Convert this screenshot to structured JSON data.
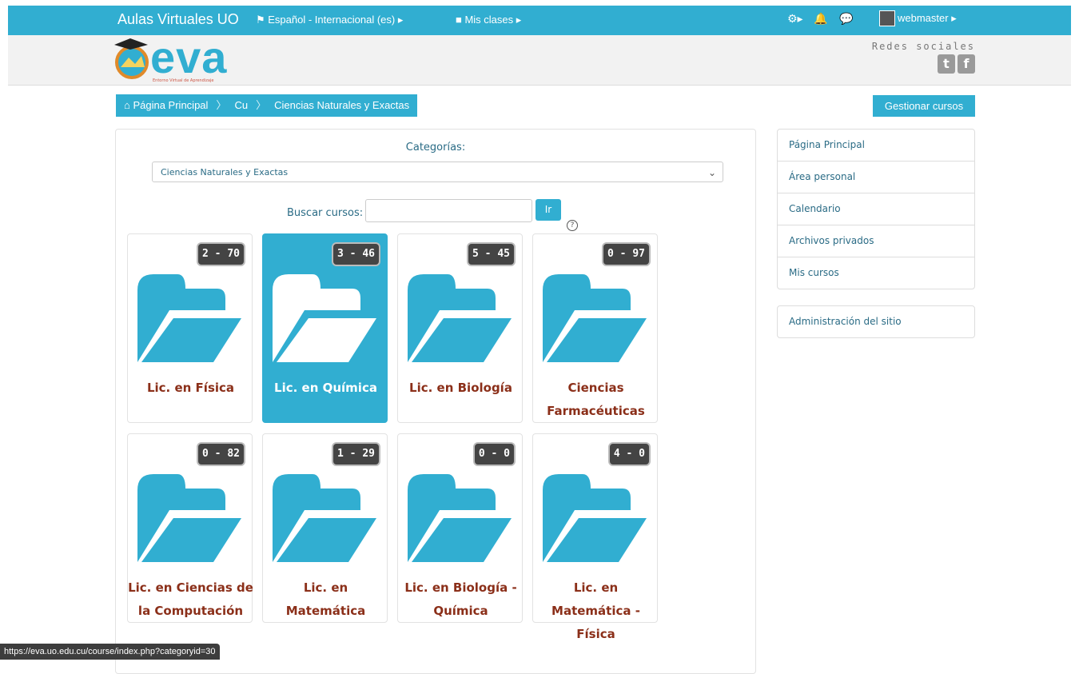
{
  "nav": {
    "site_name": "Aulas Virtuales UO",
    "language": "⚑ Español - Internacional (es) ▸",
    "classes": "■ Mis clases ▸",
    "user": "webmaster ▸",
    "settings_icon": "gear-icon",
    "notifications_icon": "bell-icon",
    "messages_icon": "chat-icon"
  },
  "header": {
    "logo_text": "eva",
    "logo_sub": "Entorno Virtual de Aprendizaje",
    "social_label": "Redes sociales"
  },
  "breadcrumb": [
    "Página Principal",
    "Cu",
    "Ciencias Naturales y Exactas"
  ],
  "manage_button": "Gestionar cursos",
  "categories": {
    "label": "Categorías:",
    "selected": "Ciencias Naturales y Exactas"
  },
  "search": {
    "label": "Buscar cursos:",
    "go_label": "Ir",
    "value": ""
  },
  "tiles": [
    {
      "badge": "2 - 70",
      "name": "Lic. en Física",
      "active": false
    },
    {
      "badge": "3 - 46",
      "name": "Lic. en Química",
      "active": true
    },
    {
      "badge": "5 - 45",
      "name": "Lic. en Biología",
      "active": false
    },
    {
      "badge": "0 - 97",
      "name": "Ciencias Farmacéuticas",
      "active": false
    },
    {
      "badge": "0 - 82",
      "name": "Lic. en Ciencias de la Computación",
      "active": false
    },
    {
      "badge": "1 - 29",
      "name": "Lic. en Matemática",
      "active": false
    },
    {
      "badge": "0 - 0",
      "name": "Lic. en Biología - Química",
      "active": false
    },
    {
      "badge": "4 - 0",
      "name": "Lic. en Matemática - Física",
      "active": false
    }
  ],
  "sidebar": {
    "nav": [
      "Página Principal",
      "Área personal",
      "Calendario",
      "Archivos privados",
      "Mis cursos"
    ],
    "admin": [
      "Administración del sitio"
    ]
  },
  "status_url": "https://eva.uo.edu.cu/course/index.php?categoryid=30",
  "colors": {
    "accent": "#31aed1",
    "title": "#8b2f19"
  }
}
